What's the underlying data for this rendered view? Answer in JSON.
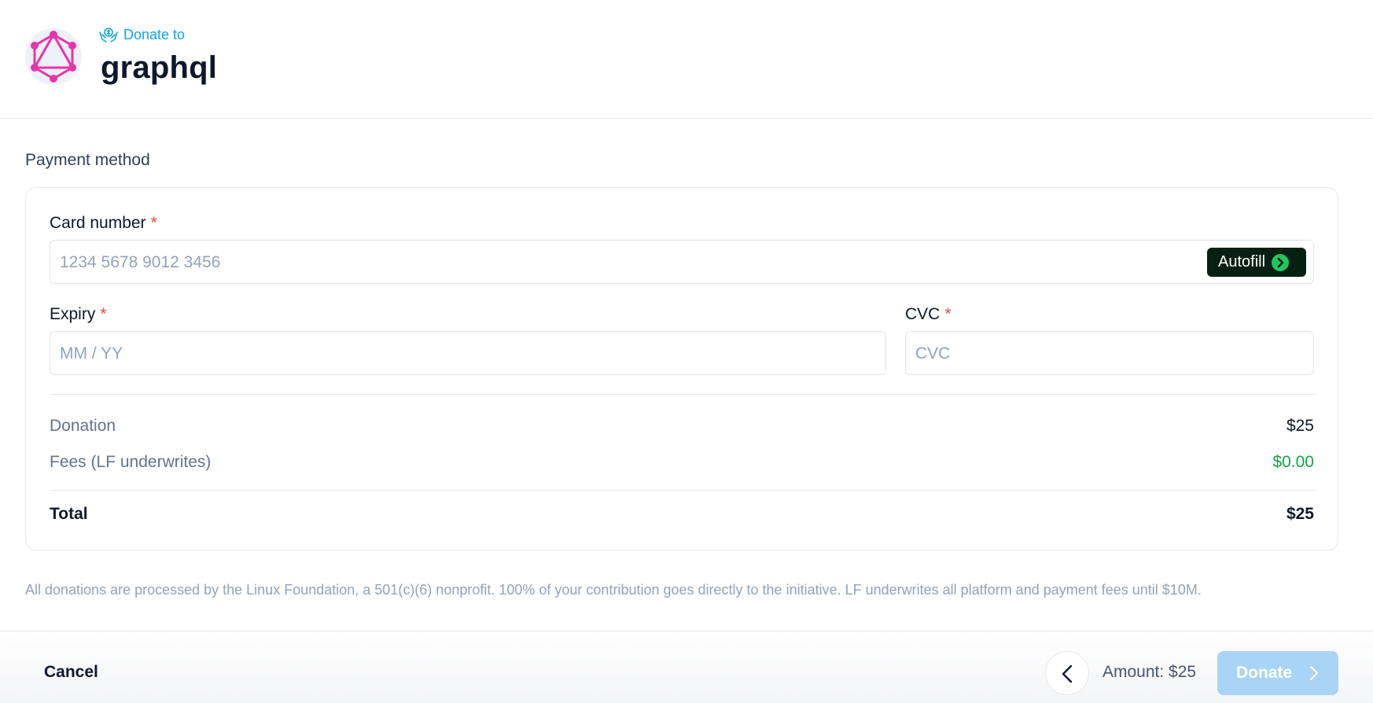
{
  "header": {
    "donate_to_label": "Donate to",
    "org_name": "graphql",
    "logo_icon": "graphql-logo",
    "accent_color": "#0ea5e9",
    "logo_color": "#e535ab"
  },
  "payment": {
    "section_label": "Payment method",
    "card_number": {
      "label": "Card number",
      "required_mark": "*",
      "placeholder": "1234 5678 9012 3456",
      "value": ""
    },
    "autofill": {
      "label": "Autofill",
      "icon": "chevron-right-circle-icon",
      "bg_color": "#052012",
      "icon_color": "#22c55e"
    },
    "expiry": {
      "label": "Expiry",
      "required_mark": "*",
      "placeholder": "MM / YY",
      "value": ""
    },
    "cvc": {
      "label": "CVC",
      "required_mark": "*",
      "placeholder": "CVC",
      "value": ""
    }
  },
  "summary": {
    "donation_label": "Donation",
    "donation_value": "$25",
    "fees_label": "Fees (LF underwrites)",
    "fees_value": "$0.00",
    "fees_color": "#16a34a",
    "total_label": "Total",
    "total_value": "$25"
  },
  "disclaimer": "All donations are processed by the Linux Foundation, a 501(c)(6) nonprofit. 100% of your contribution goes directly to the initiative. LF underwrites all platform and payment fees until $10M.",
  "footer": {
    "cancel_label": "Cancel",
    "back_icon": "chevron-left-icon",
    "amount_text": "Amount: $25",
    "donate_label": "Donate",
    "donate_icon": "chevron-right-icon",
    "donate_disabled": true,
    "donate_color": "#a9d4f5"
  }
}
